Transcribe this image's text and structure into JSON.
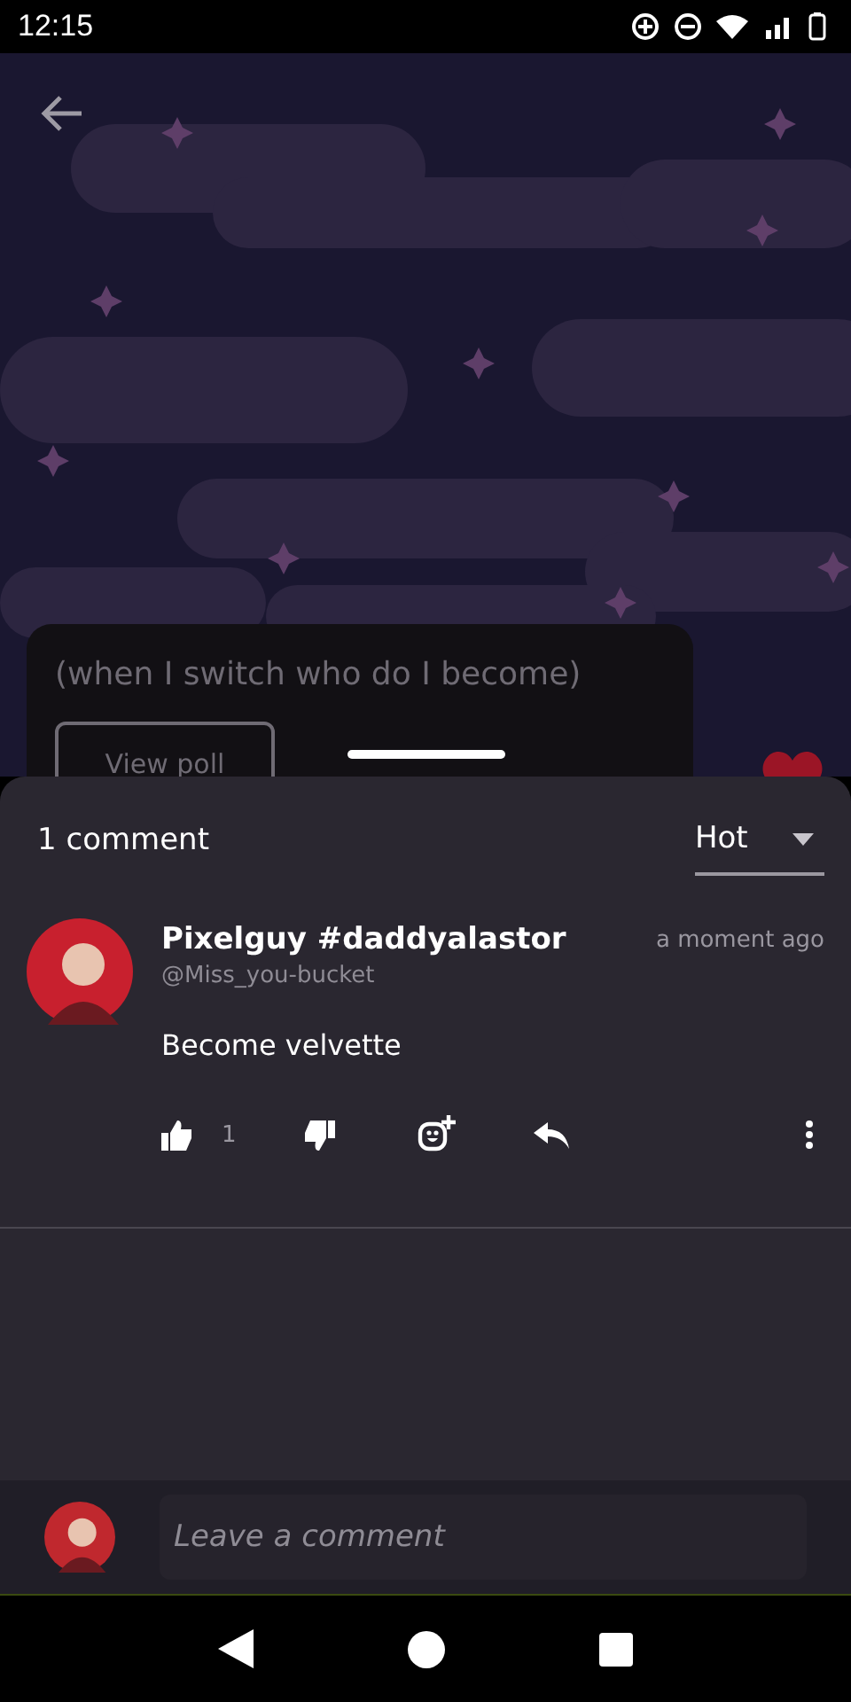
{
  "status_bar": {
    "time": "12:15"
  },
  "poll": {
    "question": "(when I switch who do I become)",
    "button": "View poll"
  },
  "comments_header": {
    "count": "1 comment",
    "sort": "Hot"
  },
  "comments": [
    {
      "name": "Pixelguy #daddyalastor",
      "handle": "@Miss_you-bucket",
      "time": "a moment ago",
      "text": "Become velvette",
      "likes": "1"
    }
  ],
  "composer": {
    "placeholder": "Leave a comment"
  }
}
